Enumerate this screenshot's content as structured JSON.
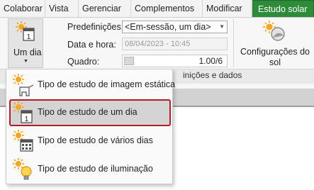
{
  "tabs": [
    {
      "label": "Colaborar",
      "active": false
    },
    {
      "label": "Vista",
      "active": false
    },
    {
      "label": "Gerenciar",
      "active": false
    },
    {
      "label": "Complementos",
      "active": false
    },
    {
      "label": "Modificar",
      "active": false
    },
    {
      "label": "Estudo solar",
      "active": true
    }
  ],
  "ribbon": {
    "study_button_label": "Um dia",
    "study_icon_day_number": "1",
    "presets_label": "Predefinições:",
    "presets_value": "<Em-sessão, um dia>",
    "date_time_label": "Data e hora:",
    "date_time_value": "08/04/2023 - 10:45",
    "frame_label": "Quadro:",
    "frame_value": "1.00/6",
    "settings_label_line1": "Configurações do",
    "settings_label_line2": "sol",
    "panel_title": "inições e dados"
  },
  "dropdown": {
    "items": [
      {
        "label": "Tipo de estudo de imagem estática",
        "icon": "still-image-study-icon",
        "selected": false
      },
      {
        "label": "Tipo de estudo de um dia",
        "icon": "single-day-study-icon",
        "selected": true
      },
      {
        "label": "Tipo de estudo de vários dias",
        "icon": "multi-day-study-icon",
        "selected": false
      },
      {
        "label": "Tipo de estudo de iluminação",
        "icon": "lighting-study-icon",
        "selected": false
      }
    ]
  },
  "colors": {
    "active_tab": "#2e8b3a",
    "sun": "#f5a623",
    "selection_outline": "#b01e2a"
  }
}
